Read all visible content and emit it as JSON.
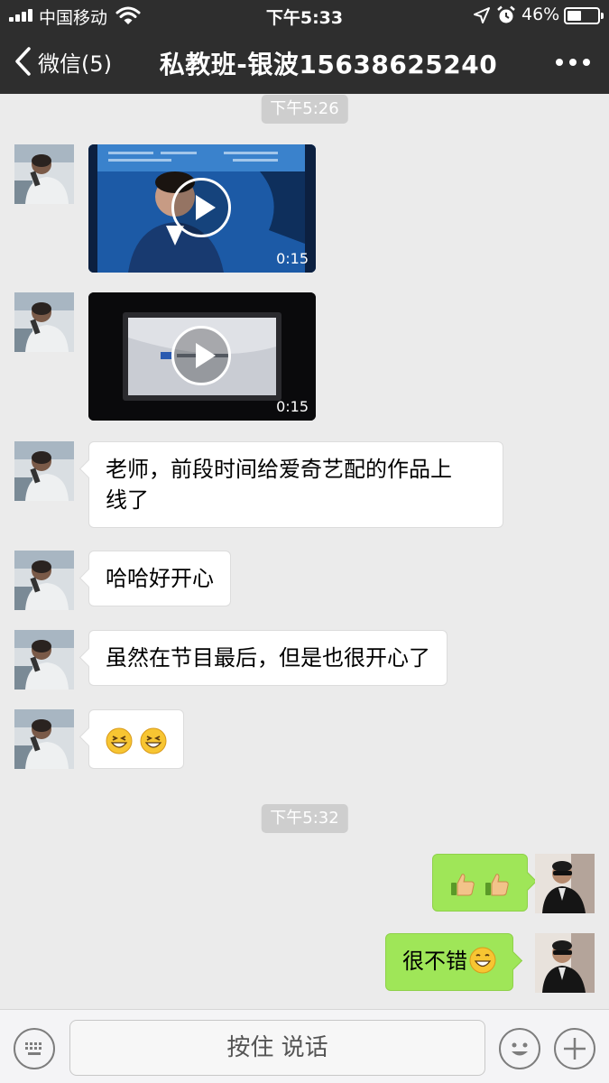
{
  "status_bar": {
    "carrier": "中国移动",
    "time": "下午5:33",
    "battery": "46%",
    "battery_level": 0.46
  },
  "nav": {
    "back_label": "微信(5)",
    "title": "私教班-银波15638625240"
  },
  "messages": {
    "time1": "下午5:26",
    "video1_duration": "0:15",
    "video2_duration": "0:15",
    "text1_line1": "老师，前段时间给爱奇艺配的作品上",
    "text1_line2": "线了",
    "text2": "哈哈好开心",
    "text3": "虽然在节目最后，但是也很开心了",
    "emoji_msg": [
      "grin-emoji",
      "grin-emoji"
    ],
    "time2": "下午5:32",
    "reply1": [
      "thumbs-up-emoji",
      "thumbs-up-emoji"
    ],
    "reply2": "很不错"
  },
  "input_bar": {
    "hold_to_talk": "按住 说话"
  },
  "colors": {
    "header_bg": "#2e2e2e",
    "chat_bg": "#ebebeb",
    "sent_bubble": "#9fe658",
    "received_bubble": "#ffffff"
  }
}
